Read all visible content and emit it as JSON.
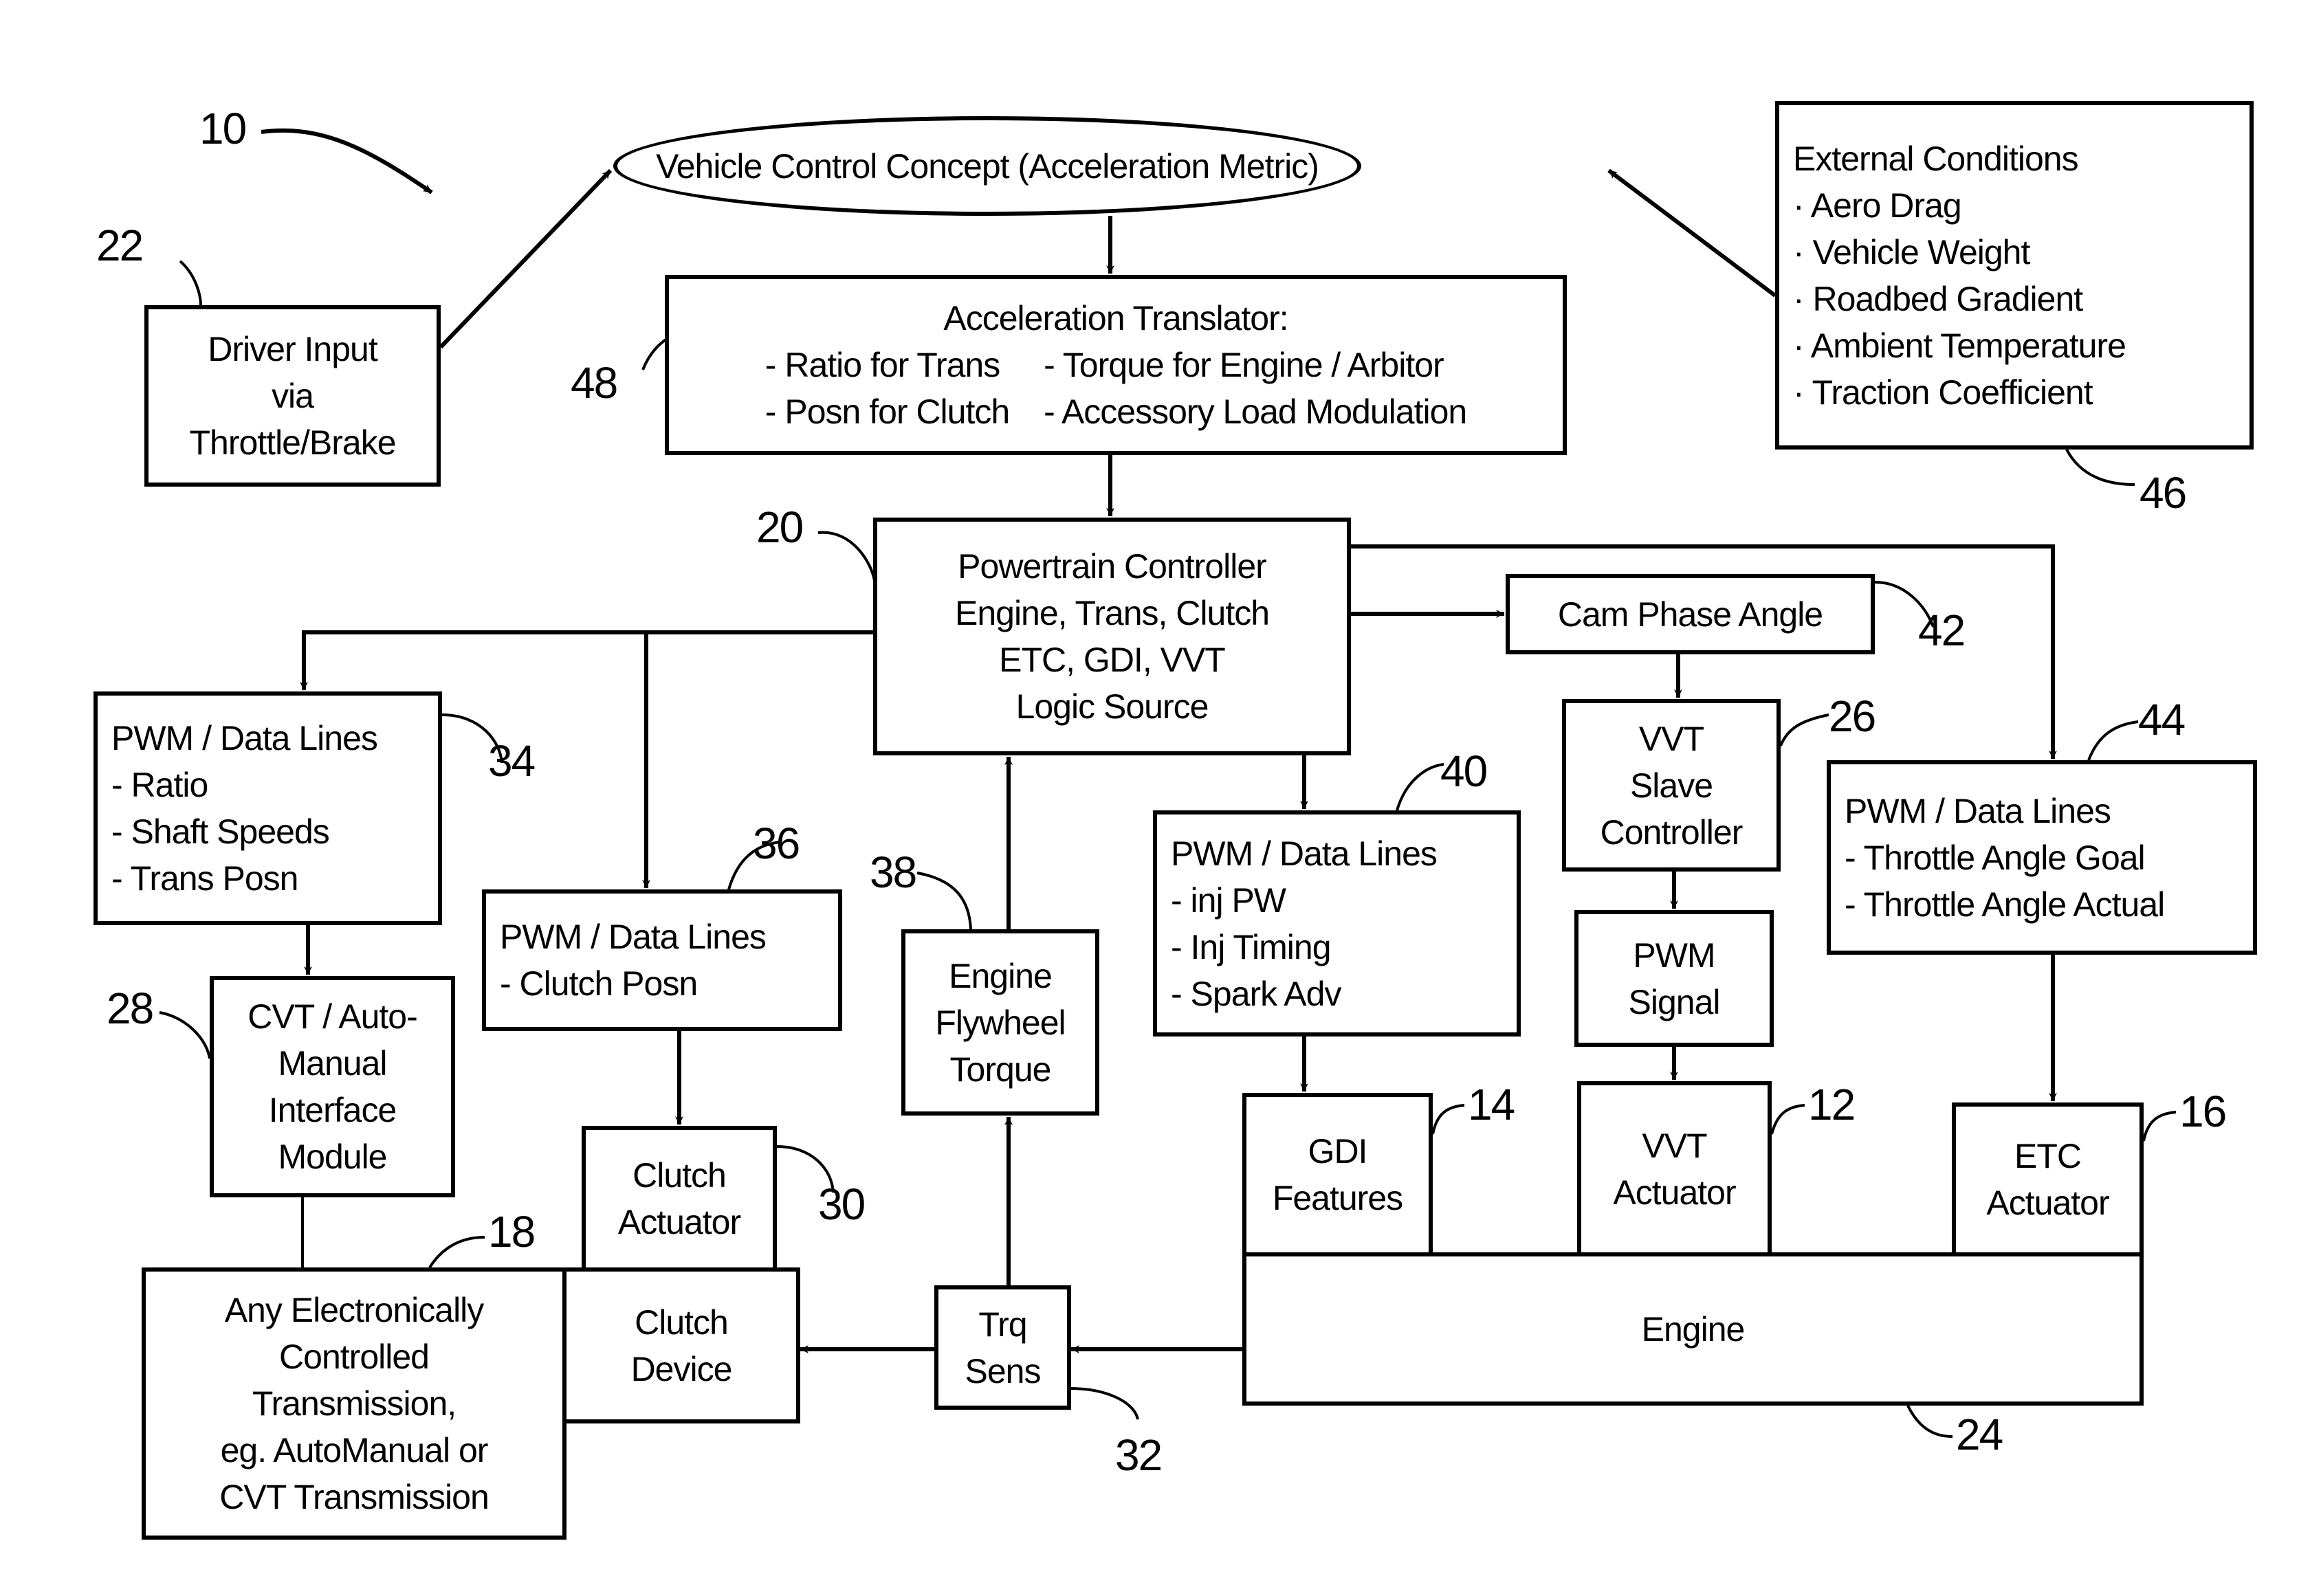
{
  "figure": {
    "number": "10",
    "nodes": {
      "vehicle_control": {
        "ref": "",
        "lines": [
          "Vehicle Control Concept  (Acceleration Metric)"
        ]
      },
      "driver_input": {
        "ref": "22",
        "lines": [
          "Driver Input",
          "via",
          "Throttle/Brake"
        ]
      },
      "external_conditions": {
        "ref": "46",
        "title": "External Conditions",
        "lines": [
          "· Aero Drag",
          "· Vehicle Weight",
          "· Roadbed Gradient",
          "· Ambient Temperature",
          "· Traction Coefficient"
        ]
      },
      "acceleration_translator": {
        "ref": "48",
        "title": "Acceleration Translator:",
        "items": [
          "- Ratio for Trans",
          "- Torque for Engine / Arbitor",
          "- Posn for Clutch",
          "- Accessory Load Modulation"
        ]
      },
      "powertrain_controller": {
        "ref": "20",
        "lines": [
          "Powertrain Controller",
          "Engine, Trans, Clutch",
          "ETC, GDI, VVT",
          "Logic Source"
        ]
      },
      "cam_phase_angle": {
        "ref": "42",
        "lines": [
          "Cam Phase Angle"
        ]
      },
      "pwm_trans": {
        "ref": "34",
        "lines": [
          "PWM / Data Lines",
          "- Ratio",
          "- Shaft Speeds",
          "- Trans Posn"
        ]
      },
      "pwm_clutch": {
        "ref": "36",
        "lines": [
          "PWM / Data Lines",
          "- Clutch Posn"
        ]
      },
      "engine_flywheel_torque": {
        "ref": "38",
        "lines": [
          "Engine",
          "Flywheel",
          "Torque"
        ]
      },
      "pwm_injection": {
        "ref": "40",
        "lines": [
          "PWM / Data Lines",
          "- inj PW",
          "- Inj Timing",
          "- Spark Adv"
        ]
      },
      "vvt_slave_controller": {
        "ref": "26",
        "lines": [
          "VVT",
          "Slave",
          "Controller"
        ]
      },
      "pwm_throttle": {
        "ref": "44",
        "lines": [
          "PWM / Data Lines",
          "- Throttle Angle Goal",
          "- Throttle Angle Actual"
        ]
      },
      "pwm_signal": {
        "ref": "",
        "lines": [
          "PWM",
          "Signal"
        ]
      },
      "cvt_interface": {
        "ref": "28",
        "lines": [
          "CVT / Auto-",
          "Manual",
          "Interface",
          "Module"
        ]
      },
      "clutch_actuator": {
        "ref": "30",
        "lines": [
          "Clutch",
          "Actuator"
        ]
      },
      "gdi_features": {
        "ref": "14",
        "lines": [
          "GDI",
          "Features"
        ]
      },
      "vvt_actuator": {
        "ref": "12",
        "lines": [
          "VVT",
          "Actuator"
        ]
      },
      "etc_actuator": {
        "ref": "16",
        "lines": [
          "ETC",
          "Actuator"
        ]
      },
      "engine": {
        "ref": "24",
        "lines": [
          "Engine"
        ]
      },
      "transmission": {
        "ref": "18",
        "lines": [
          "Any Electronically",
          "Controlled",
          "Transmission,",
          "eg. AutoManual or",
          "CVT Transmission"
        ]
      },
      "clutch_device": {
        "ref": "",
        "lines": [
          "Clutch",
          "Device"
        ]
      },
      "torque_sensor": {
        "ref": "32",
        "lines": [
          "Trq",
          "Sens"
        ]
      }
    }
  }
}
